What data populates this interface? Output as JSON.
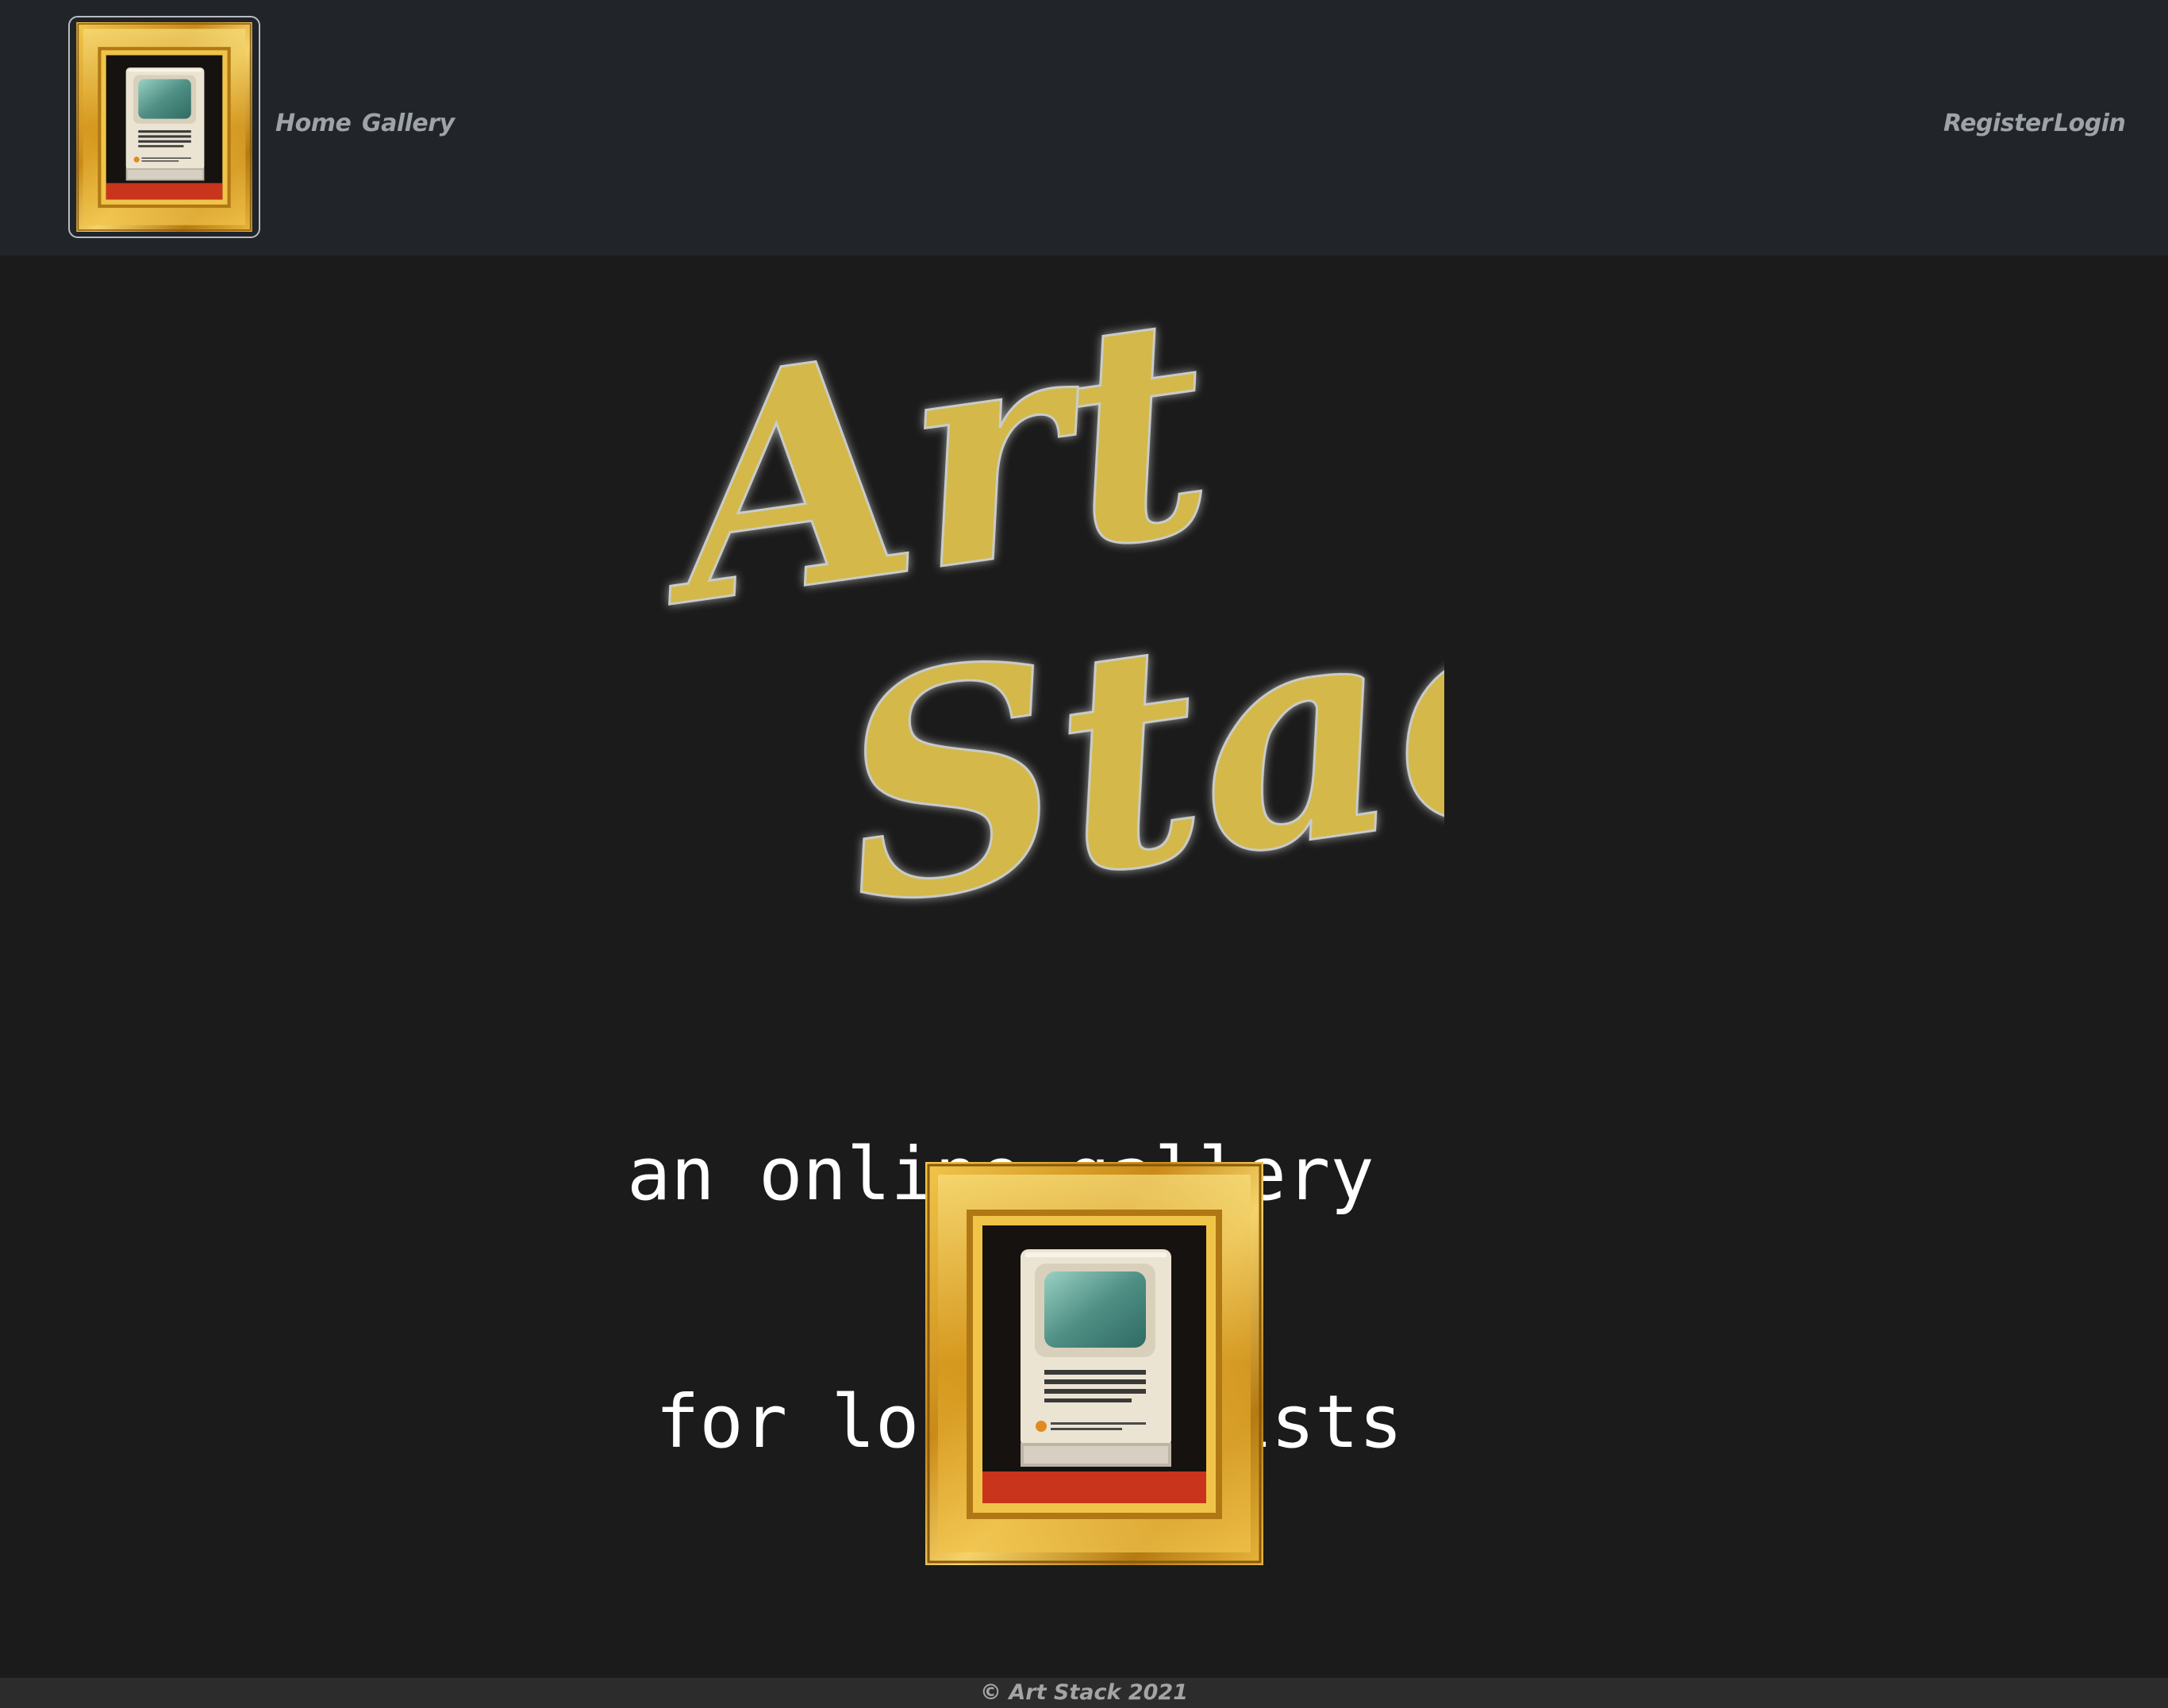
{
  "navbar": {
    "brand_icon": "framed-computer-painting",
    "links_left": [
      {
        "label": "Home"
      },
      {
        "label": "Gallery"
      }
    ],
    "links_right": [
      {
        "label": "Register"
      },
      {
        "label": "Login"
      }
    ]
  },
  "hero": {
    "logo_text": "Art Stack",
    "tagline_line1": "an online gallery",
    "tagline_line2": "for local artists",
    "painting_icon": "framed-computer-painting"
  },
  "footer": {
    "text": "© Art Stack 2021"
  },
  "colors": {
    "navbar_bg": "#212529",
    "page_bg": "#1b1b1b",
    "logo_gold": "#d4b84a",
    "frame_gold": "#d49a1c",
    "link_gray": "#9ea3a8",
    "footer_bg": "#2c2c2c"
  }
}
